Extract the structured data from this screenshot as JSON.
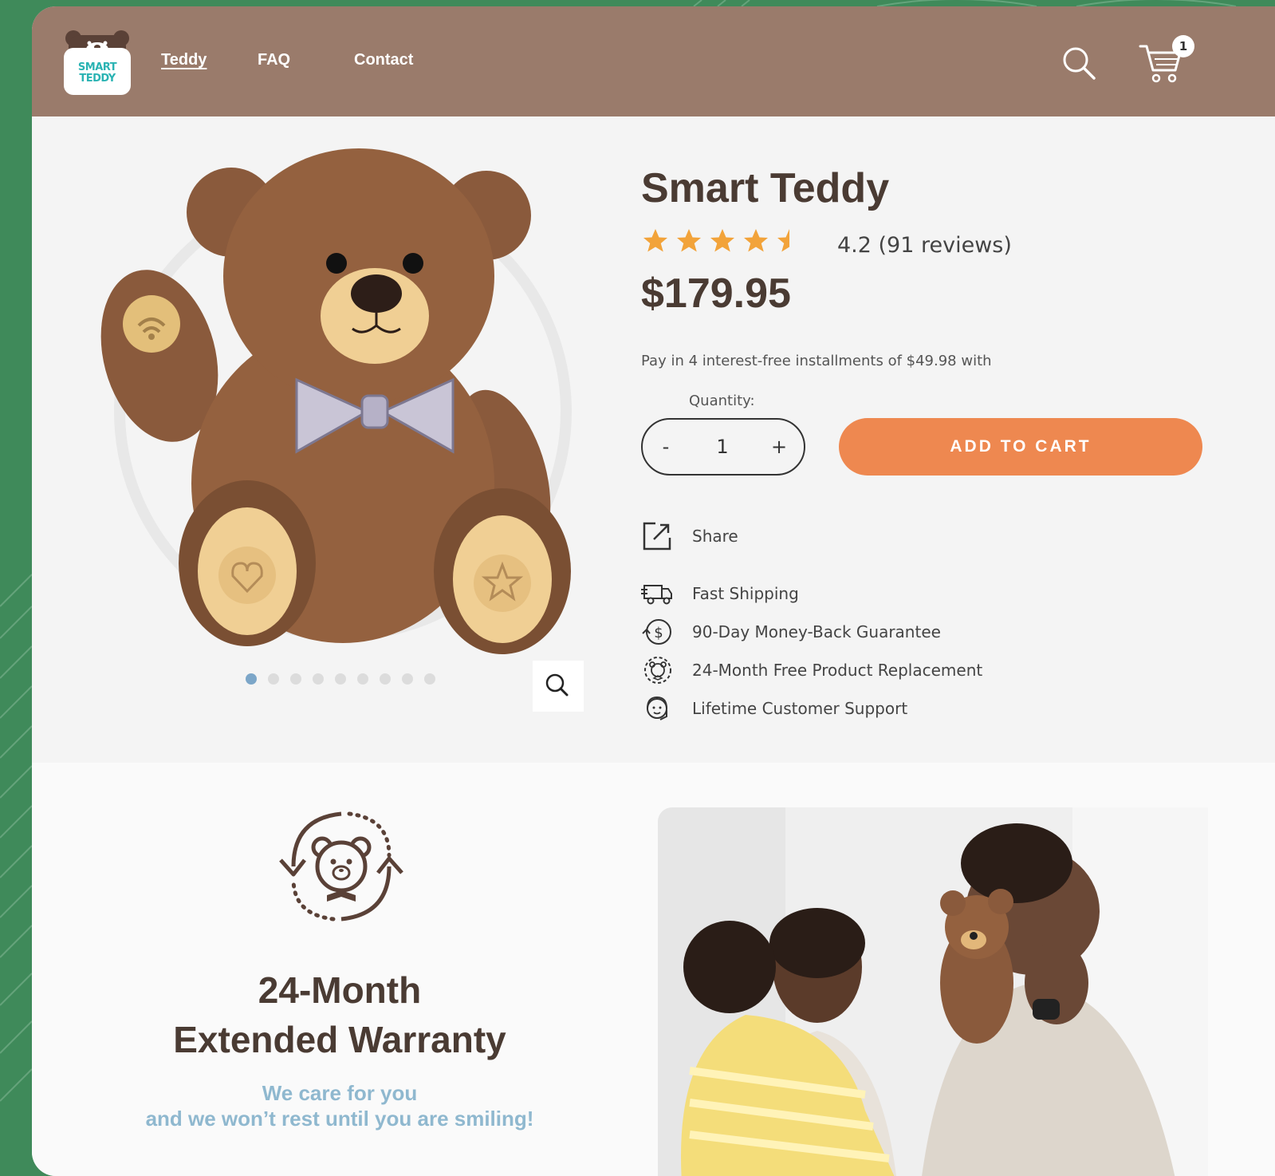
{
  "header": {
    "logo_text_1": "SMART",
    "logo_text_2": "TEDDY",
    "nav": [
      {
        "label": "Teddy"
      },
      {
        "label": "FAQ"
      },
      {
        "label": "Contact"
      }
    ],
    "cart_count": "1"
  },
  "product": {
    "title": "Smart Teddy",
    "rating_text": "4.2 (91 reviews)",
    "rating_value": 4.2,
    "rating_max": 5,
    "price": "$179.95",
    "installments": "Pay in 4 interest-free installments of $49.98 with",
    "quantity_label": "Quantity:",
    "quantity_minus": "-",
    "quantity_value": "1",
    "quantity_plus": "+",
    "add_to_cart": "ADD TO CART",
    "share_label": "Share",
    "gallery_image_count": 9,
    "gallery_active_index": 0,
    "features": [
      {
        "icon": "truck-icon",
        "label": "Fast Shipping"
      },
      {
        "icon": "money-back-icon",
        "label": "90-Day Money-Back Guarantee"
      },
      {
        "icon": "replacement-icon",
        "label": "24-Month Free Product Replacement"
      },
      {
        "icon": "support-icon",
        "label": "Lifetime Customer Support"
      }
    ]
  },
  "warranty": {
    "title_line1": "24-Month",
    "title_line2": "Extended Warranty",
    "sub_line1": "We care for you",
    "sub_line2": "and we won’t rest until you are smiling!"
  },
  "colors": {
    "background": "#3f8a5a",
    "header": "#9a7b6b",
    "accent": "#ee8850",
    "heading": "#4a3b33",
    "subtext_blue": "#8fb8cf"
  }
}
